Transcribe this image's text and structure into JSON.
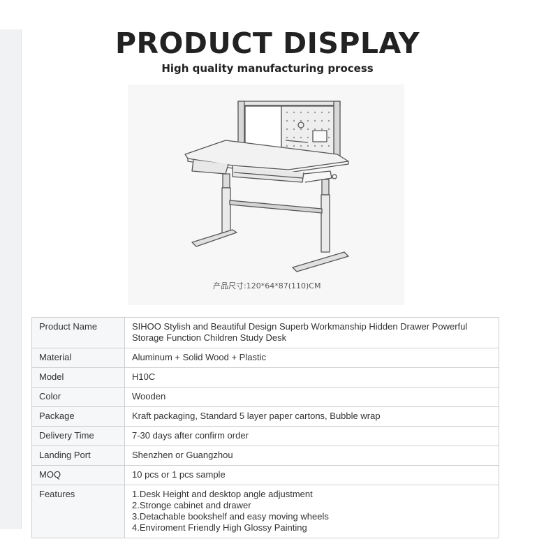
{
  "header": {
    "title": "PRODUCT DISPLAY",
    "subtitle": "High quality manufacturing process"
  },
  "product_image": {
    "caption": "产品尺寸:120*64*87(110)CM"
  },
  "specs": [
    {
      "label": "Product Name",
      "value": "SIHOO Stylish and Beautiful Design Superb Workmanship Hidden Drawer Powerful Storage Function Children Study Desk"
    },
    {
      "label": "Material",
      "value": "Aluminum + Solid Wood + Plastic"
    },
    {
      "label": "Model",
      "value": "H10C"
    },
    {
      "label": "Color",
      "value": "Wooden"
    },
    {
      "label": "Package",
      "value": "Kraft packaging, Standard 5 layer paper cartons, Bubble wrap"
    },
    {
      "label": "Delivery Time",
      "value": "7-30 days after confirm order"
    },
    {
      "label": "Landing Port",
      "value": "Shenzhen or Guangzhou"
    },
    {
      "label": "MOQ",
      "value": "10 pcs or 1 pcs sample"
    },
    {
      "label": "Features",
      "lines": [
        "1.Desk Height and desktop angle adjustment",
        "2.Stronge cabinet and drawer",
        "3.Detachable bookshelf and easy moving wheels",
        "4.Enviroment Friendly High Glossy Painting"
      ]
    }
  ]
}
